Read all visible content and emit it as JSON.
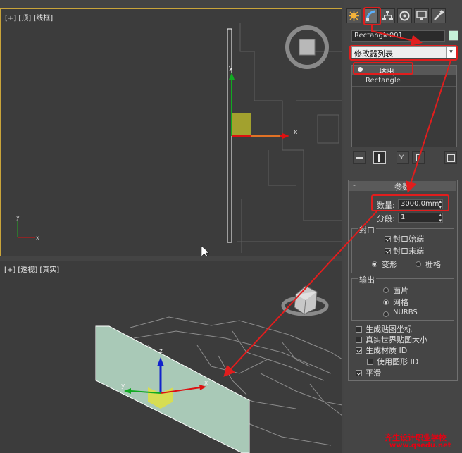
{
  "top_viewport": {
    "label": "[+] [顶] [线框]"
  },
  "persp_viewport": {
    "label": "[+] [透视] [真实]"
  },
  "axes": {
    "x": "x",
    "y": "y",
    "z": "z"
  },
  "command_panel": {
    "tabs": [
      "create-icon",
      "modify-icon",
      "hierarchy-icon",
      "motion-icon",
      "display-icon",
      "utilities-icon"
    ],
    "object_name": "Rectangle001",
    "object_color": "#c6f0d8",
    "modifier_list_label": "修改器列表",
    "stack": [
      {
        "label": "挤出",
        "selected": true
      },
      {
        "label": "Rectangle",
        "selected": false
      }
    ],
    "rollout_title": "参数",
    "amount_label": "数量:",
    "amount_value": "3000.0mm",
    "segments_label": "分段:",
    "segments_value": "1",
    "capping": {
      "title": "封口",
      "cap_start": "封口始端",
      "cap_end": "封口末端",
      "cap_start_checked": true,
      "cap_end_checked": true,
      "morph": "变形",
      "grid": "栅格",
      "selected": "变形"
    },
    "output": {
      "title": "输出",
      "patch": "面片",
      "mesh": "网格",
      "nurbs": "NURBS",
      "selected": "网格"
    },
    "options": [
      {
        "label": "生成贴图坐标",
        "checked": false
      },
      {
        "label": "真实世界贴图大小",
        "checked": false
      },
      {
        "label": "生成材质 ID",
        "checked": true
      },
      {
        "label": "使用图形 ID",
        "checked": false
      },
      {
        "label": "平滑",
        "checked": true
      }
    ]
  },
  "watermark": {
    "line1": "齐生设计职业学校",
    "line2": "www.qsedu.net"
  },
  "colors": {
    "highlight": "#e11d1d",
    "viewport_border": "#c9a43a",
    "wall": "#a9c9b7"
  }
}
